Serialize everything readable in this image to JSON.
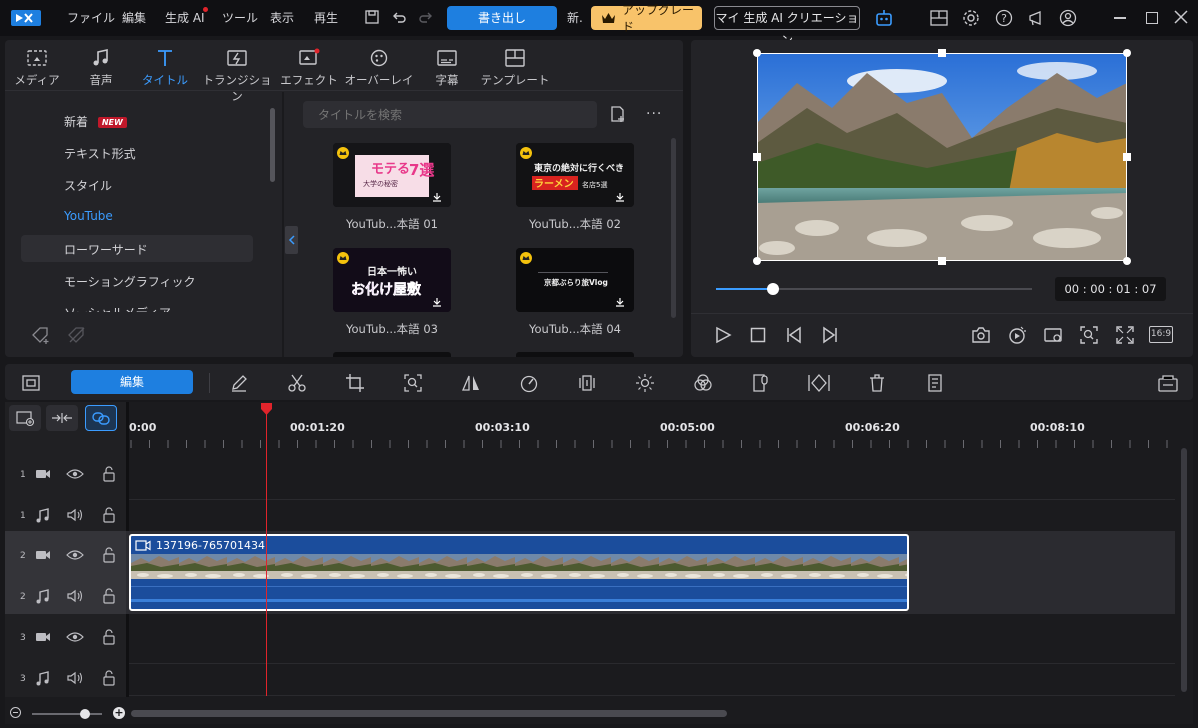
{
  "menu": {
    "items": [
      "ファイル",
      "編集",
      "生成 AI",
      "ツール",
      "表示",
      "再生"
    ],
    "export_label": "書き出し",
    "new_label": "新.",
    "upgrade_label": "アップグレード",
    "my_ai_label": "マイ 生成 AI クリエーション"
  },
  "media_tabs": [
    {
      "label": "メディア",
      "icon": "media-icon"
    },
    {
      "label": "音声",
      "icon": "music-note-icon"
    },
    {
      "label": "タイトル",
      "icon": "title-T-icon",
      "active": true
    },
    {
      "label": "トランジション",
      "icon": "transition-icon"
    },
    {
      "label": "エフェクト",
      "icon": "effect-icon"
    },
    {
      "label": "オーバーレイ",
      "icon": "overlay-icon"
    },
    {
      "label": "字幕",
      "icon": "subtitle-icon"
    },
    {
      "label": "テンプレート",
      "icon": "template-icon"
    }
  ],
  "categories": {
    "new_label": "新着",
    "new_badge": "NEW",
    "items": [
      "テキスト形式",
      "スタイル",
      "YouTube",
      "ローワーサード",
      "モーショングラフィック",
      "ソーシャルメディア"
    ]
  },
  "search": {
    "placeholder": "タイトルを検索"
  },
  "templates": [
    {
      "label": "YouTub...本語 01",
      "art_line1": "モテる",
      "art_line2": "大学の秘密",
      "art_num": "7選"
    },
    {
      "label": "YouTub...本語 02",
      "art_line1": "東京の絶対に行くべき",
      "art_line2": "ラーメン",
      "art_sub": "名店5選"
    },
    {
      "label": "YouTub...本語 03",
      "art_line1": "日本一怖い",
      "art_line2": "お化け屋敷"
    },
    {
      "label": "YouTub...本語 04",
      "art_line1": "京都ぶらり旅Vlog"
    }
  ],
  "preview": {
    "timecode": "00 : 00 : 01 : 07",
    "aspect_label": "16:9",
    "progress": 0.18
  },
  "toolbar": {
    "edit_label": "編集"
  },
  "timeline": {
    "ticks": [
      "0:00",
      "00:01:20",
      "00:03:10",
      "00:05:00",
      "00:06:20",
      "00:08:10"
    ],
    "tracks": [
      {
        "num": "1",
        "type": "video"
      },
      {
        "num": "1",
        "type": "audio"
      },
      {
        "num": "2",
        "type": "video"
      },
      {
        "num": "2",
        "type": "audio"
      },
      {
        "num": "3",
        "type": "video"
      },
      {
        "num": "3",
        "type": "audio"
      }
    ],
    "clip_name": "137196-765701434"
  },
  "colors": {
    "accent": "#1e7fe0",
    "playhead": "#e0242b",
    "clip": "#1b4d9c",
    "upgrade": "#f8c36a"
  }
}
